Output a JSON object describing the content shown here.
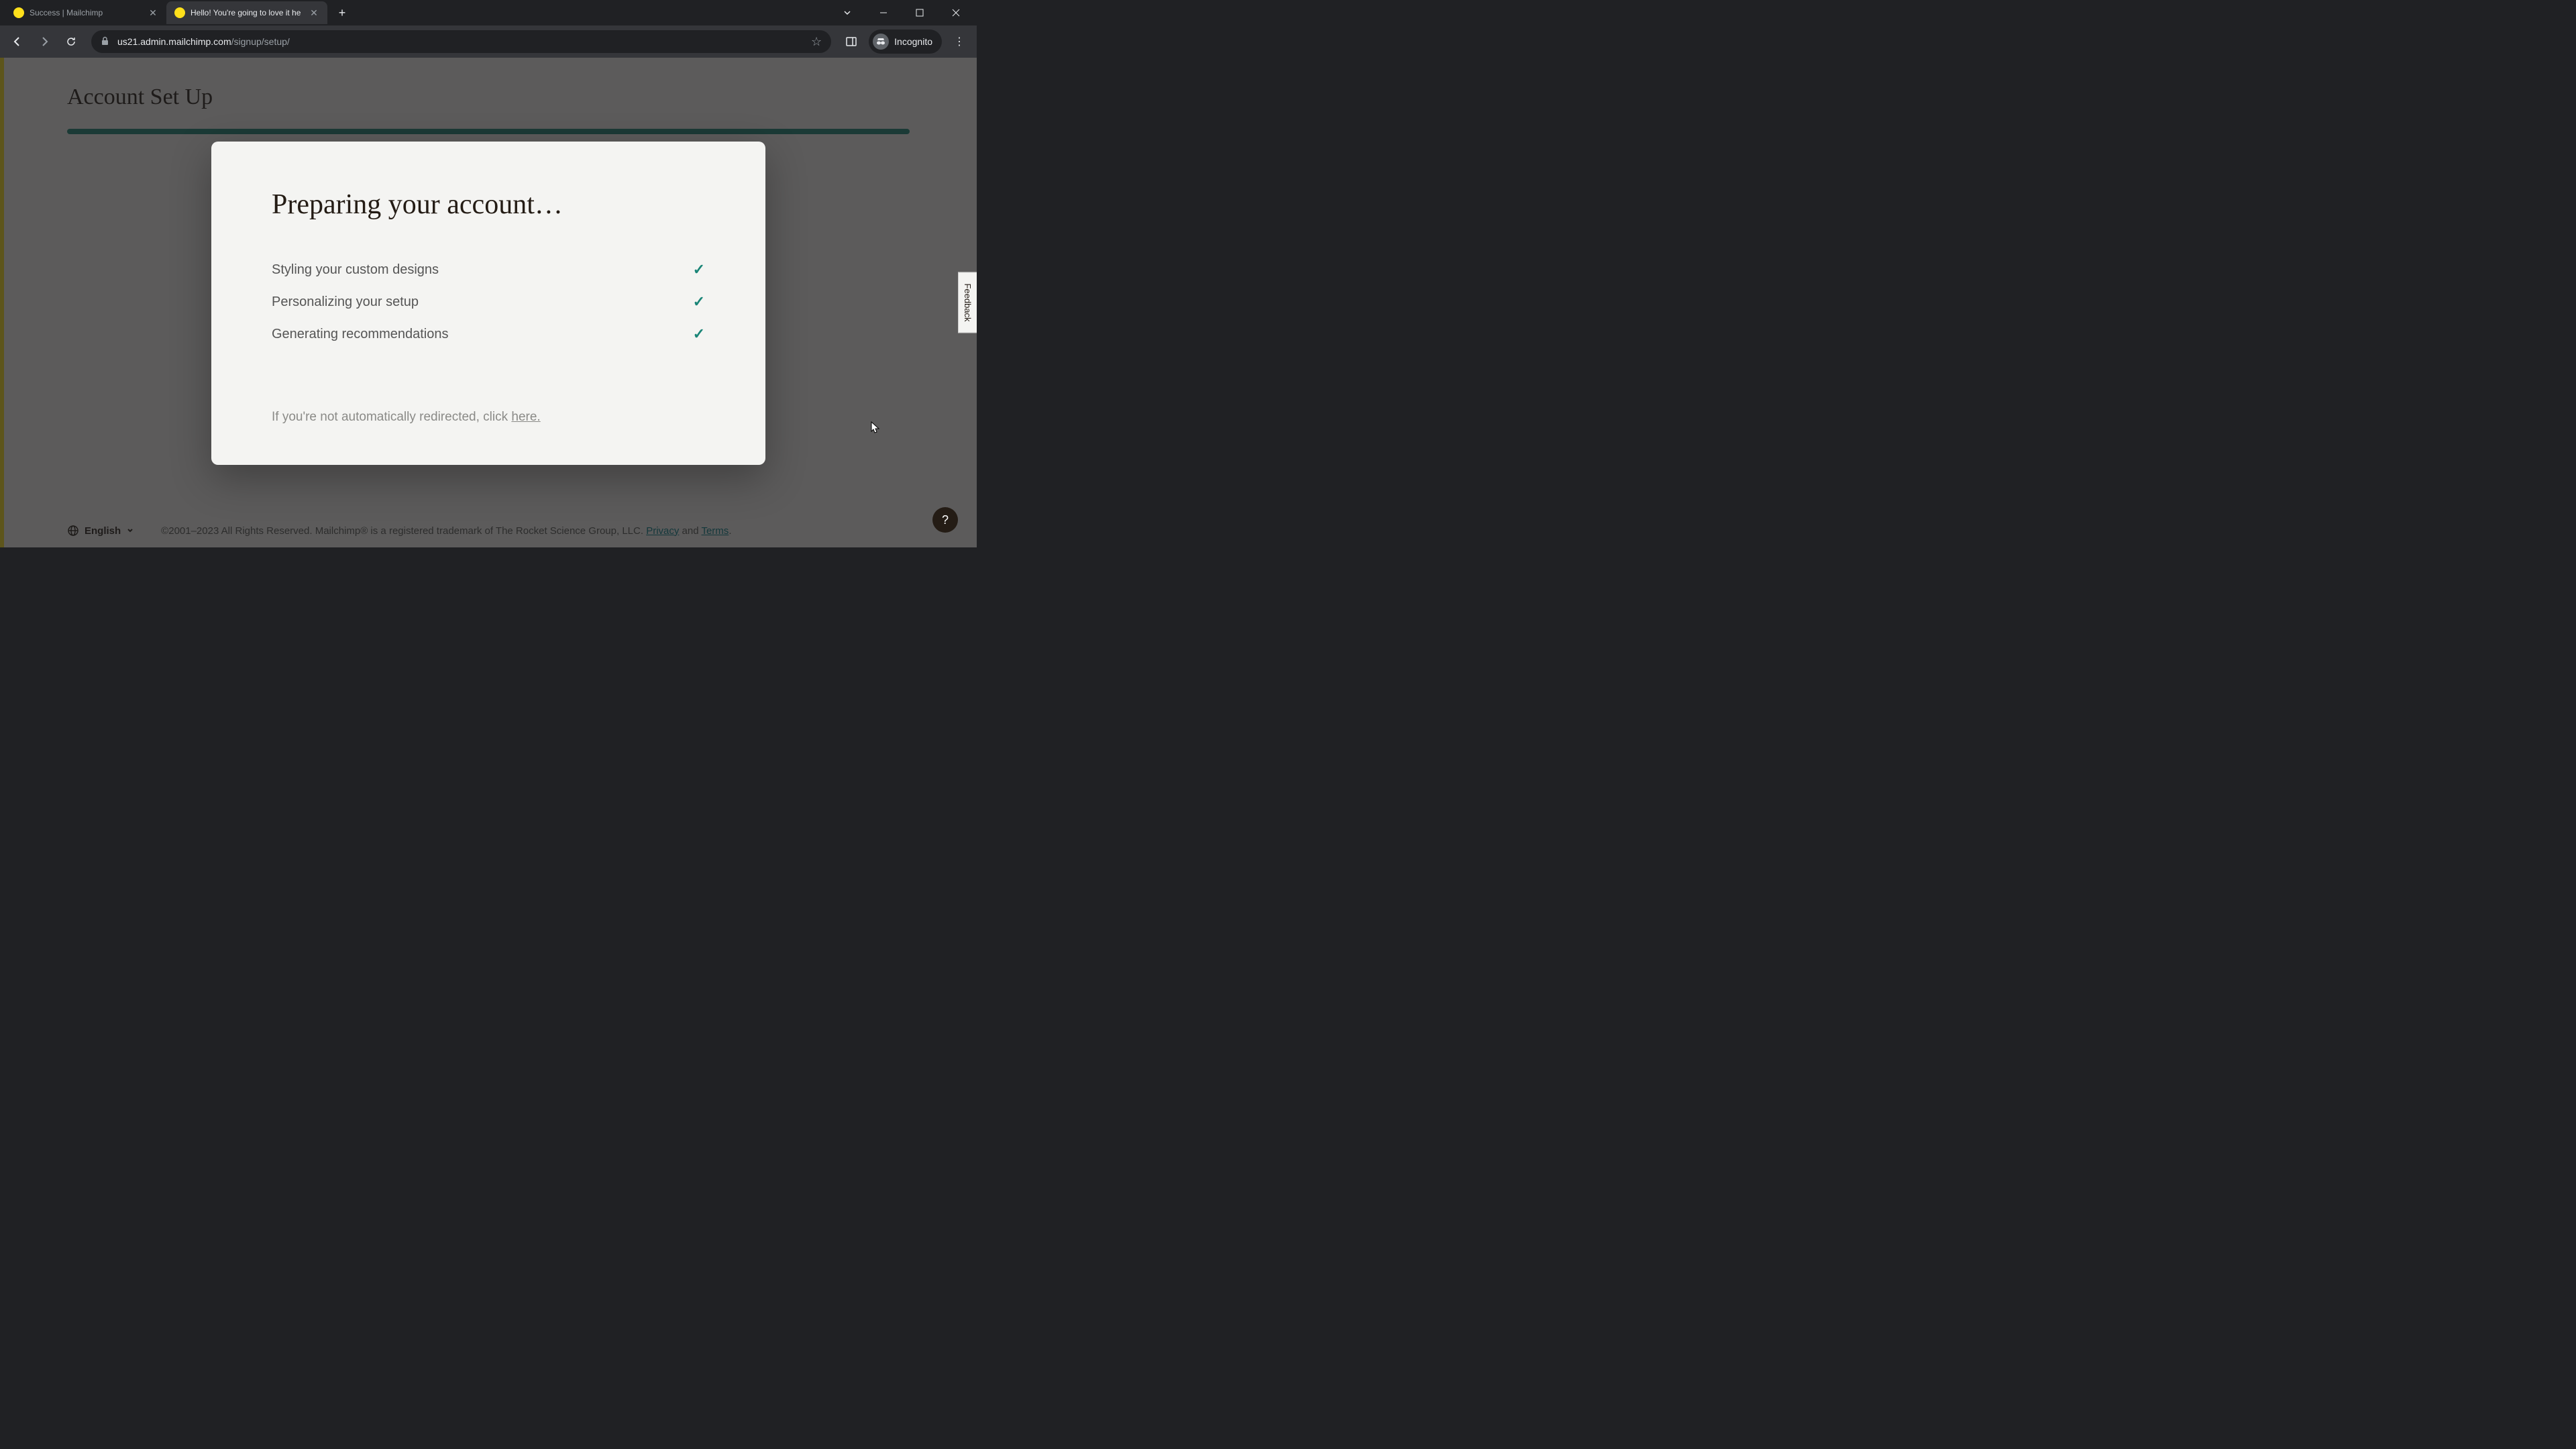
{
  "browser": {
    "tabs": [
      {
        "title": "Success | Mailchimp",
        "active": false
      },
      {
        "title": "Hello! You're going to love it he",
        "active": true
      }
    ],
    "url_host": "us21.admin.mailchimp.com",
    "url_path": "/signup/setup/",
    "incognito_label": "Incognito"
  },
  "page": {
    "title": "Account Set Up",
    "feedback": "Feedback"
  },
  "modal": {
    "title": "Preparing your account…",
    "items": [
      "Styling your custom designs",
      "Personalizing your setup",
      "Generating recommendations"
    ],
    "redirect_prefix": "If you're not automatically redirected, click ",
    "redirect_link": "here."
  },
  "footer": {
    "language": "English",
    "copyright": "©2001–2023 All Rights Reserved. Mailchimp® is a registered trademark of The Rocket Science Group, LLC. ",
    "privacy": "Privacy",
    "and": " and ",
    "terms": "Terms",
    "period": "."
  },
  "help": "?"
}
